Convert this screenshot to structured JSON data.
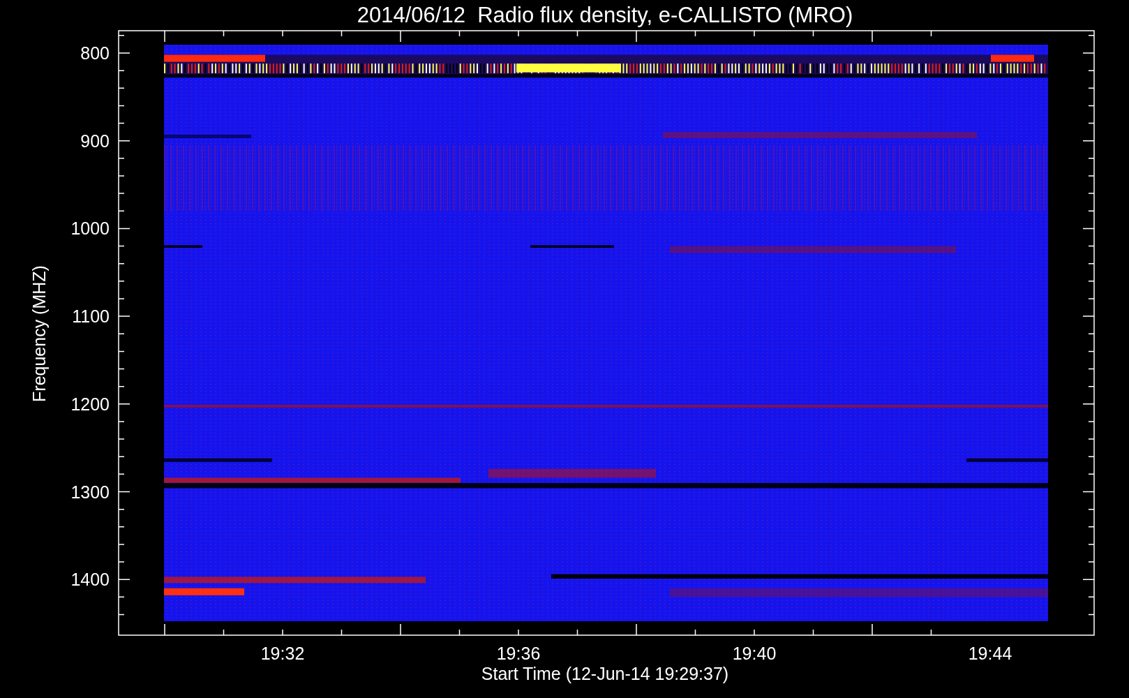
{
  "title": "2014/06/12  Radio flux density, e-CALLISTO (MRO)",
  "y_axis": {
    "label": "Frequency (MHZ)",
    "ticks": [
      "800",
      "900",
      "1000",
      "1100",
      "1200",
      "1300",
      "1400"
    ]
  },
  "x_axis": {
    "label": "Start Time (12-Jun-14 19:29:37)",
    "ticks": [
      "19:32",
      "19:36",
      "19:40",
      "19:44"
    ]
  }
}
